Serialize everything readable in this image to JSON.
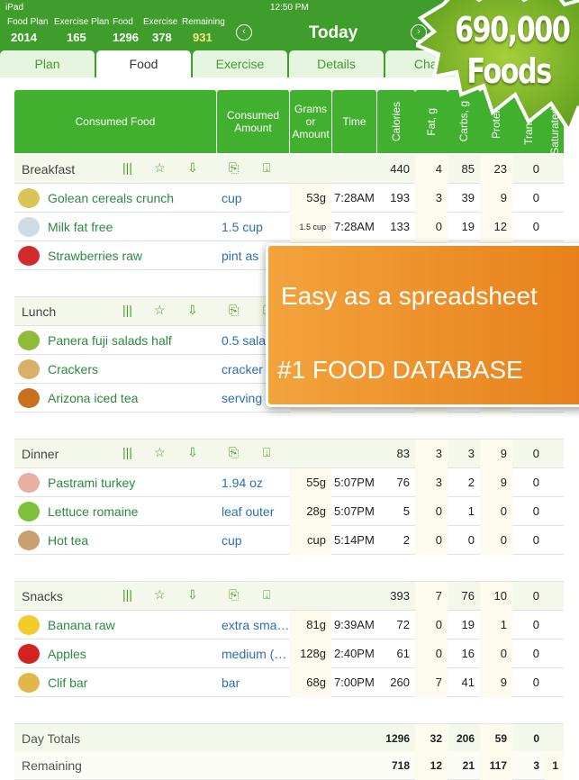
{
  "status": {
    "device": "iPad",
    "time": "12:50 PM"
  },
  "stats": [
    {
      "label": "Food Plan",
      "value": "2014"
    },
    {
      "label": "Exercise Plan",
      "value": "165"
    },
    {
      "label": "Food",
      "value": "1296"
    },
    {
      "label": "Exercise",
      "value": "378"
    },
    {
      "label": "Remaining",
      "value": "931"
    }
  ],
  "title": "Today",
  "tabs": [
    "Plan",
    "Food",
    "Exercise",
    "Details",
    "Charts"
  ],
  "headers": [
    "Consumed Food",
    "Consumed Amount",
    "Grams or Amount",
    "Time",
    "Calories",
    "Fat, g",
    "Carbs, g",
    "Protein",
    "Trans Fat",
    "Saturated Fat"
  ],
  "sections": [
    {
      "name": "Breakfast",
      "totals": [
        "440",
        "4",
        "85",
        "23",
        "0"
      ],
      "items": [
        {
          "food": "Golean cereals crunch",
          "amount": "cup",
          "grams": "53g",
          "time": "7:28AM",
          "vals": [
            "193",
            "3",
            "39",
            "9",
            "0"
          ],
          "color": "#d9c45a"
        },
        {
          "food": "Milk fat free",
          "amount": "1.5 cup",
          "grams": "1.5 cup",
          "time": "7:28AM",
          "vals": [
            "133",
            "0",
            "19",
            "12",
            "0"
          ],
          "color": "#cfdbe6"
        },
        {
          "food": "Strawberries raw",
          "amount": "pint as",
          "grams": "",
          "time": "",
          "vals": [
            "",
            "",
            "",
            "",
            ""
          ],
          "color": "#d22b2b"
        }
      ]
    },
    {
      "name": "Lunch",
      "totals": [
        "",
        "",
        "",
        "",
        ""
      ],
      "items": [
        {
          "food": "Panera fuji salads half",
          "amount": "0.5 sala",
          "grams": "",
          "time": "",
          "vals": [
            "",
            "",
            "",
            "",
            ""
          ],
          "color": "#8dbb3a"
        },
        {
          "food": "Crackers",
          "amount": "cracker",
          "grams": "",
          "time": "",
          "vals": [
            "",
            "",
            "",
            "",
            ""
          ],
          "color": "#d9b06a"
        },
        {
          "food": "Arizona iced tea",
          "amount": "serving",
          "grams": "",
          "time": "",
          "vals": [
            "",
            "",
            "",
            "",
            ""
          ],
          "color": "#c9701c"
        }
      ]
    },
    {
      "name": "Dinner",
      "totals": [
        "83",
        "3",
        "3",
        "9",
        "0"
      ],
      "items": [
        {
          "food": "Pastrami turkey",
          "amount": "1.94 oz",
          "grams": "55g",
          "time": "5:07PM",
          "vals": [
            "76",
            "3",
            "2",
            "9",
            "0"
          ],
          "color": "#e8b0a0"
        },
        {
          "food": "Lettuce romaine",
          "amount": "leaf outer",
          "grams": "28g",
          "time": "5:07PM",
          "vals": [
            "5",
            "0",
            "1",
            "0",
            "0"
          ],
          "color": "#7fbf3a"
        },
        {
          "food": "Hot tea",
          "amount": "cup",
          "grams": "cup",
          "time": "5:14PM",
          "vals": [
            "2",
            "0",
            "0",
            "0",
            "0"
          ],
          "color": "#c8a070"
        }
      ]
    },
    {
      "name": "Snacks",
      "totals": [
        "393",
        "7",
        "76",
        "10",
        "0"
      ],
      "items": [
        {
          "food": "Banana raw",
          "amount": "extra sma…",
          "grams": "81g",
          "time": "9:39AM",
          "vals": [
            "72",
            "0",
            "19",
            "1",
            "0"
          ],
          "color": "#f2cc2a"
        },
        {
          "food": "Apples",
          "amount": "medium (…",
          "grams": "128g",
          "time": "2:40PM",
          "vals": [
            "61",
            "0",
            "16",
            "0",
            "0"
          ],
          "color": "#d1231f"
        },
        {
          "food": "Clif bar",
          "amount": "bar",
          "grams": "68g",
          "time": "7:00PM",
          "vals": [
            "260",
            "7",
            "41",
            "9",
            "0"
          ],
          "color": "#e0b84a"
        }
      ]
    }
  ],
  "day_totals": {
    "label": "Day Totals",
    "vals": [
      "1296",
      "32",
      "206",
      "59",
      "0"
    ]
  },
  "remaining": {
    "label": "Remaining",
    "vals": [
      "718",
      "12",
      "21",
      "117",
      "3",
      "1"
    ]
  },
  "promo": {
    "line1": "Easy as a spreadsheet",
    "line2": "#1 FOOD DATABASE",
    "badge_line1": "690,000",
    "badge_line2": "Foods"
  }
}
